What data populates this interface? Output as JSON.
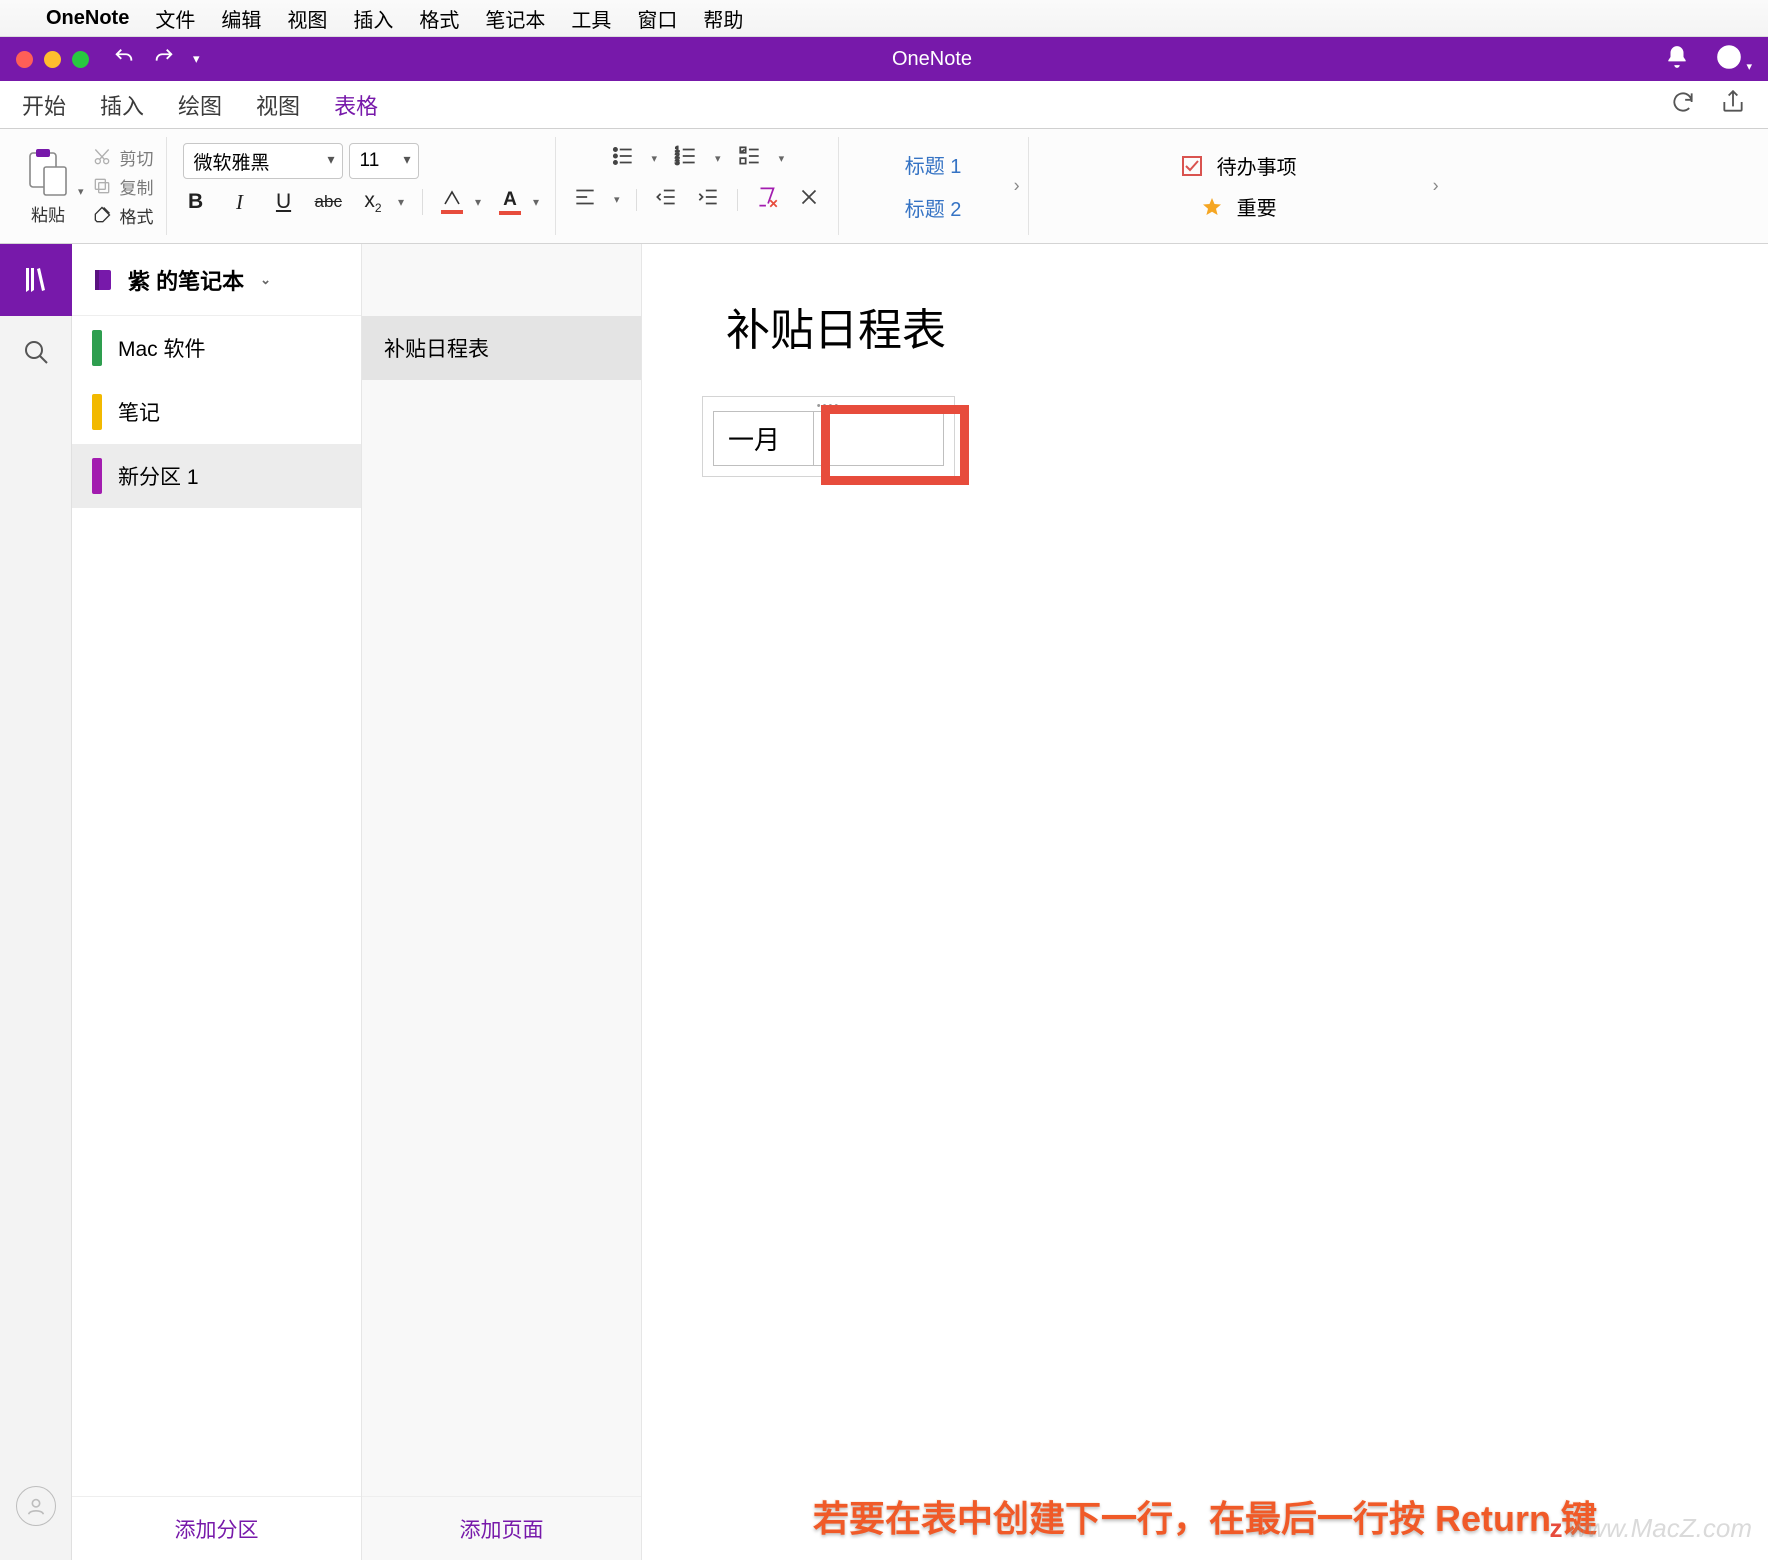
{
  "menubar": {
    "app": "OneNote",
    "items": [
      "文件",
      "编辑",
      "视图",
      "插入",
      "格式",
      "笔记本",
      "工具",
      "窗口",
      "帮助"
    ]
  },
  "titlebar": {
    "title": "OneNote"
  },
  "ribbon_tabs": {
    "items": [
      "开始",
      "插入",
      "绘图",
      "视图",
      "表格"
    ],
    "active_index": 4
  },
  "clipboard": {
    "paste": "粘贴",
    "cut": "剪切",
    "copy": "复制",
    "format": "格式"
  },
  "font": {
    "name": "微软雅黑",
    "size": "11"
  },
  "fmt": {
    "bold": "B",
    "italic": "I",
    "underline": "U",
    "strike": "abc",
    "sub": "x",
    "sub2": "2"
  },
  "headings": {
    "h1": "标题 1",
    "h2": "标题 2"
  },
  "tags": {
    "todo": "待办事项",
    "important": "重要"
  },
  "notebook": {
    "name": "紫 的笔记本"
  },
  "sections": {
    "items": [
      {
        "label": "Mac 软件",
        "color": "#2e9e4f"
      },
      {
        "label": "笔记",
        "color": "#f2b900"
      },
      {
        "label": "新分区 1",
        "color": "#a21caf"
      }
    ],
    "active_index": 2,
    "add": "添加分区"
  },
  "pages": {
    "items": [
      "补贴日程表"
    ],
    "active_index": 0,
    "add": "添加页面"
  },
  "page": {
    "title": "补贴日程表",
    "table_cell": "一月"
  },
  "caption": "若要在表中创建下一行，在最后一行按 Return 键",
  "watermark": "www.MacZ.com"
}
